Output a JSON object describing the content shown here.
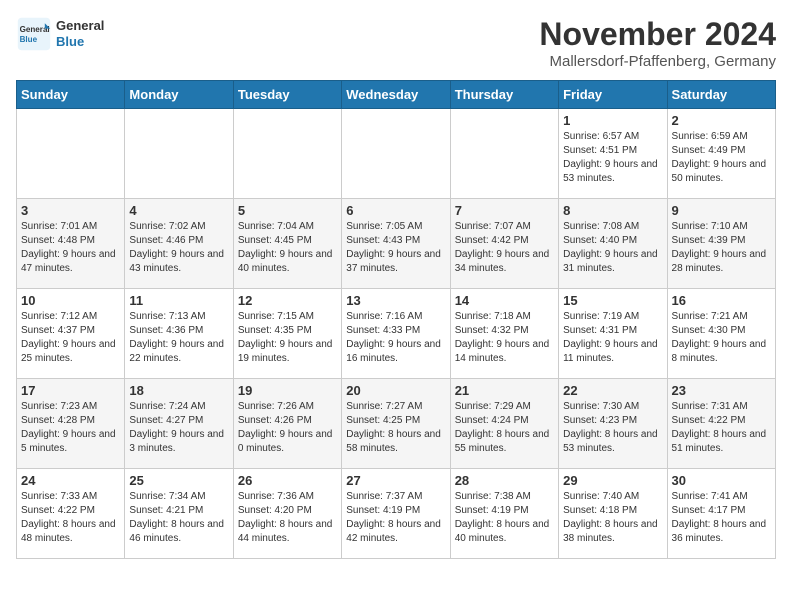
{
  "logo": {
    "text_general": "General",
    "text_blue": "Blue"
  },
  "header": {
    "title": "November 2024",
    "subtitle": "Mallersdorf-Pfaffenberg, Germany"
  },
  "weekdays": [
    "Sunday",
    "Monday",
    "Tuesday",
    "Wednesday",
    "Thursday",
    "Friday",
    "Saturday"
  ],
  "weeks": [
    [
      {
        "day": "",
        "info": ""
      },
      {
        "day": "",
        "info": ""
      },
      {
        "day": "",
        "info": ""
      },
      {
        "day": "",
        "info": ""
      },
      {
        "day": "",
        "info": ""
      },
      {
        "day": "1",
        "info": "Sunrise: 6:57 AM\nSunset: 4:51 PM\nDaylight: 9 hours and 53 minutes."
      },
      {
        "day": "2",
        "info": "Sunrise: 6:59 AM\nSunset: 4:49 PM\nDaylight: 9 hours and 50 minutes."
      }
    ],
    [
      {
        "day": "3",
        "info": "Sunrise: 7:01 AM\nSunset: 4:48 PM\nDaylight: 9 hours and 47 minutes."
      },
      {
        "day": "4",
        "info": "Sunrise: 7:02 AM\nSunset: 4:46 PM\nDaylight: 9 hours and 43 minutes."
      },
      {
        "day": "5",
        "info": "Sunrise: 7:04 AM\nSunset: 4:45 PM\nDaylight: 9 hours and 40 minutes."
      },
      {
        "day": "6",
        "info": "Sunrise: 7:05 AM\nSunset: 4:43 PM\nDaylight: 9 hours and 37 minutes."
      },
      {
        "day": "7",
        "info": "Sunrise: 7:07 AM\nSunset: 4:42 PM\nDaylight: 9 hours and 34 minutes."
      },
      {
        "day": "8",
        "info": "Sunrise: 7:08 AM\nSunset: 4:40 PM\nDaylight: 9 hours and 31 minutes."
      },
      {
        "day": "9",
        "info": "Sunrise: 7:10 AM\nSunset: 4:39 PM\nDaylight: 9 hours and 28 minutes."
      }
    ],
    [
      {
        "day": "10",
        "info": "Sunrise: 7:12 AM\nSunset: 4:37 PM\nDaylight: 9 hours and 25 minutes."
      },
      {
        "day": "11",
        "info": "Sunrise: 7:13 AM\nSunset: 4:36 PM\nDaylight: 9 hours and 22 minutes."
      },
      {
        "day": "12",
        "info": "Sunrise: 7:15 AM\nSunset: 4:35 PM\nDaylight: 9 hours and 19 minutes."
      },
      {
        "day": "13",
        "info": "Sunrise: 7:16 AM\nSunset: 4:33 PM\nDaylight: 9 hours and 16 minutes."
      },
      {
        "day": "14",
        "info": "Sunrise: 7:18 AM\nSunset: 4:32 PM\nDaylight: 9 hours and 14 minutes."
      },
      {
        "day": "15",
        "info": "Sunrise: 7:19 AM\nSunset: 4:31 PM\nDaylight: 9 hours and 11 minutes."
      },
      {
        "day": "16",
        "info": "Sunrise: 7:21 AM\nSunset: 4:30 PM\nDaylight: 9 hours and 8 minutes."
      }
    ],
    [
      {
        "day": "17",
        "info": "Sunrise: 7:23 AM\nSunset: 4:28 PM\nDaylight: 9 hours and 5 minutes."
      },
      {
        "day": "18",
        "info": "Sunrise: 7:24 AM\nSunset: 4:27 PM\nDaylight: 9 hours and 3 minutes."
      },
      {
        "day": "19",
        "info": "Sunrise: 7:26 AM\nSunset: 4:26 PM\nDaylight: 9 hours and 0 minutes."
      },
      {
        "day": "20",
        "info": "Sunrise: 7:27 AM\nSunset: 4:25 PM\nDaylight: 8 hours and 58 minutes."
      },
      {
        "day": "21",
        "info": "Sunrise: 7:29 AM\nSunset: 4:24 PM\nDaylight: 8 hours and 55 minutes."
      },
      {
        "day": "22",
        "info": "Sunrise: 7:30 AM\nSunset: 4:23 PM\nDaylight: 8 hours and 53 minutes."
      },
      {
        "day": "23",
        "info": "Sunrise: 7:31 AM\nSunset: 4:22 PM\nDaylight: 8 hours and 51 minutes."
      }
    ],
    [
      {
        "day": "24",
        "info": "Sunrise: 7:33 AM\nSunset: 4:22 PM\nDaylight: 8 hours and 48 minutes."
      },
      {
        "day": "25",
        "info": "Sunrise: 7:34 AM\nSunset: 4:21 PM\nDaylight: 8 hours and 46 minutes."
      },
      {
        "day": "26",
        "info": "Sunrise: 7:36 AM\nSunset: 4:20 PM\nDaylight: 8 hours and 44 minutes."
      },
      {
        "day": "27",
        "info": "Sunrise: 7:37 AM\nSunset: 4:19 PM\nDaylight: 8 hours and 42 minutes."
      },
      {
        "day": "28",
        "info": "Sunrise: 7:38 AM\nSunset: 4:19 PM\nDaylight: 8 hours and 40 minutes."
      },
      {
        "day": "29",
        "info": "Sunrise: 7:40 AM\nSunset: 4:18 PM\nDaylight: 8 hours and 38 minutes."
      },
      {
        "day": "30",
        "info": "Sunrise: 7:41 AM\nSunset: 4:17 PM\nDaylight: 8 hours and 36 minutes."
      }
    ]
  ]
}
